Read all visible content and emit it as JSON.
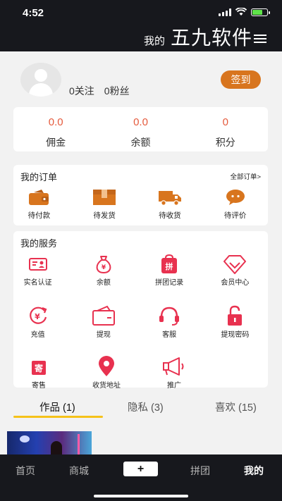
{
  "status_bar": {
    "time": "4:52"
  },
  "header": {
    "title_small": "我的",
    "title_big": "五九软件"
  },
  "profile": {
    "following": "0关注",
    "followers": "0粉丝",
    "signin_label": "签到"
  },
  "wallet": [
    {
      "value": "0.0",
      "label": "佣金"
    },
    {
      "value": "0.0",
      "label": "余额"
    },
    {
      "value": "0",
      "label": "积分"
    }
  ],
  "orders": {
    "title": "我的订单",
    "all_link": "全部订单>",
    "items": [
      {
        "label": "待付款",
        "icon": "wallet-icon"
      },
      {
        "label": "待发货",
        "icon": "box-icon"
      },
      {
        "label": "待收货",
        "icon": "truck-icon"
      },
      {
        "label": "待评价",
        "icon": "comment-icon"
      }
    ]
  },
  "services": {
    "title": "我的服务",
    "items": [
      {
        "label": "实名认证",
        "icon": "id-card-icon"
      },
      {
        "label": "余额",
        "icon": "money-bag-icon"
      },
      {
        "label": "拼团记录",
        "icon": "group-buy-icon"
      },
      {
        "label": "会员中心",
        "icon": "diamond-icon"
      },
      {
        "label": "充值",
        "icon": "recharge-icon"
      },
      {
        "label": "提现",
        "icon": "withdraw-icon"
      },
      {
        "label": "客服",
        "icon": "headset-icon"
      },
      {
        "label": "提现密码",
        "icon": "lock-icon"
      },
      {
        "label": "寄售",
        "icon": "consign-icon"
      },
      {
        "label": "收货地址",
        "icon": "location-icon"
      },
      {
        "label": "推广",
        "icon": "megaphone-icon"
      }
    ]
  },
  "content_tabs": [
    {
      "label": "作品 (1)",
      "active": true
    },
    {
      "label": "隐私 (3)",
      "active": false
    },
    {
      "label": "喜欢 (15)",
      "active": false
    }
  ],
  "bottom_nav": [
    {
      "label": "首页",
      "active": false
    },
    {
      "label": "商城",
      "active": false
    },
    {
      "label": "+",
      "active": false
    },
    {
      "label": "拼团",
      "active": false
    },
    {
      "label": "我的",
      "active": true
    }
  ],
  "colors": {
    "accent_orange": "#d8751e",
    "value_red": "#e55a3c",
    "service_red": "#e8314f",
    "tab_underline": "#f5c21a",
    "dark_bar": "#17181d"
  }
}
